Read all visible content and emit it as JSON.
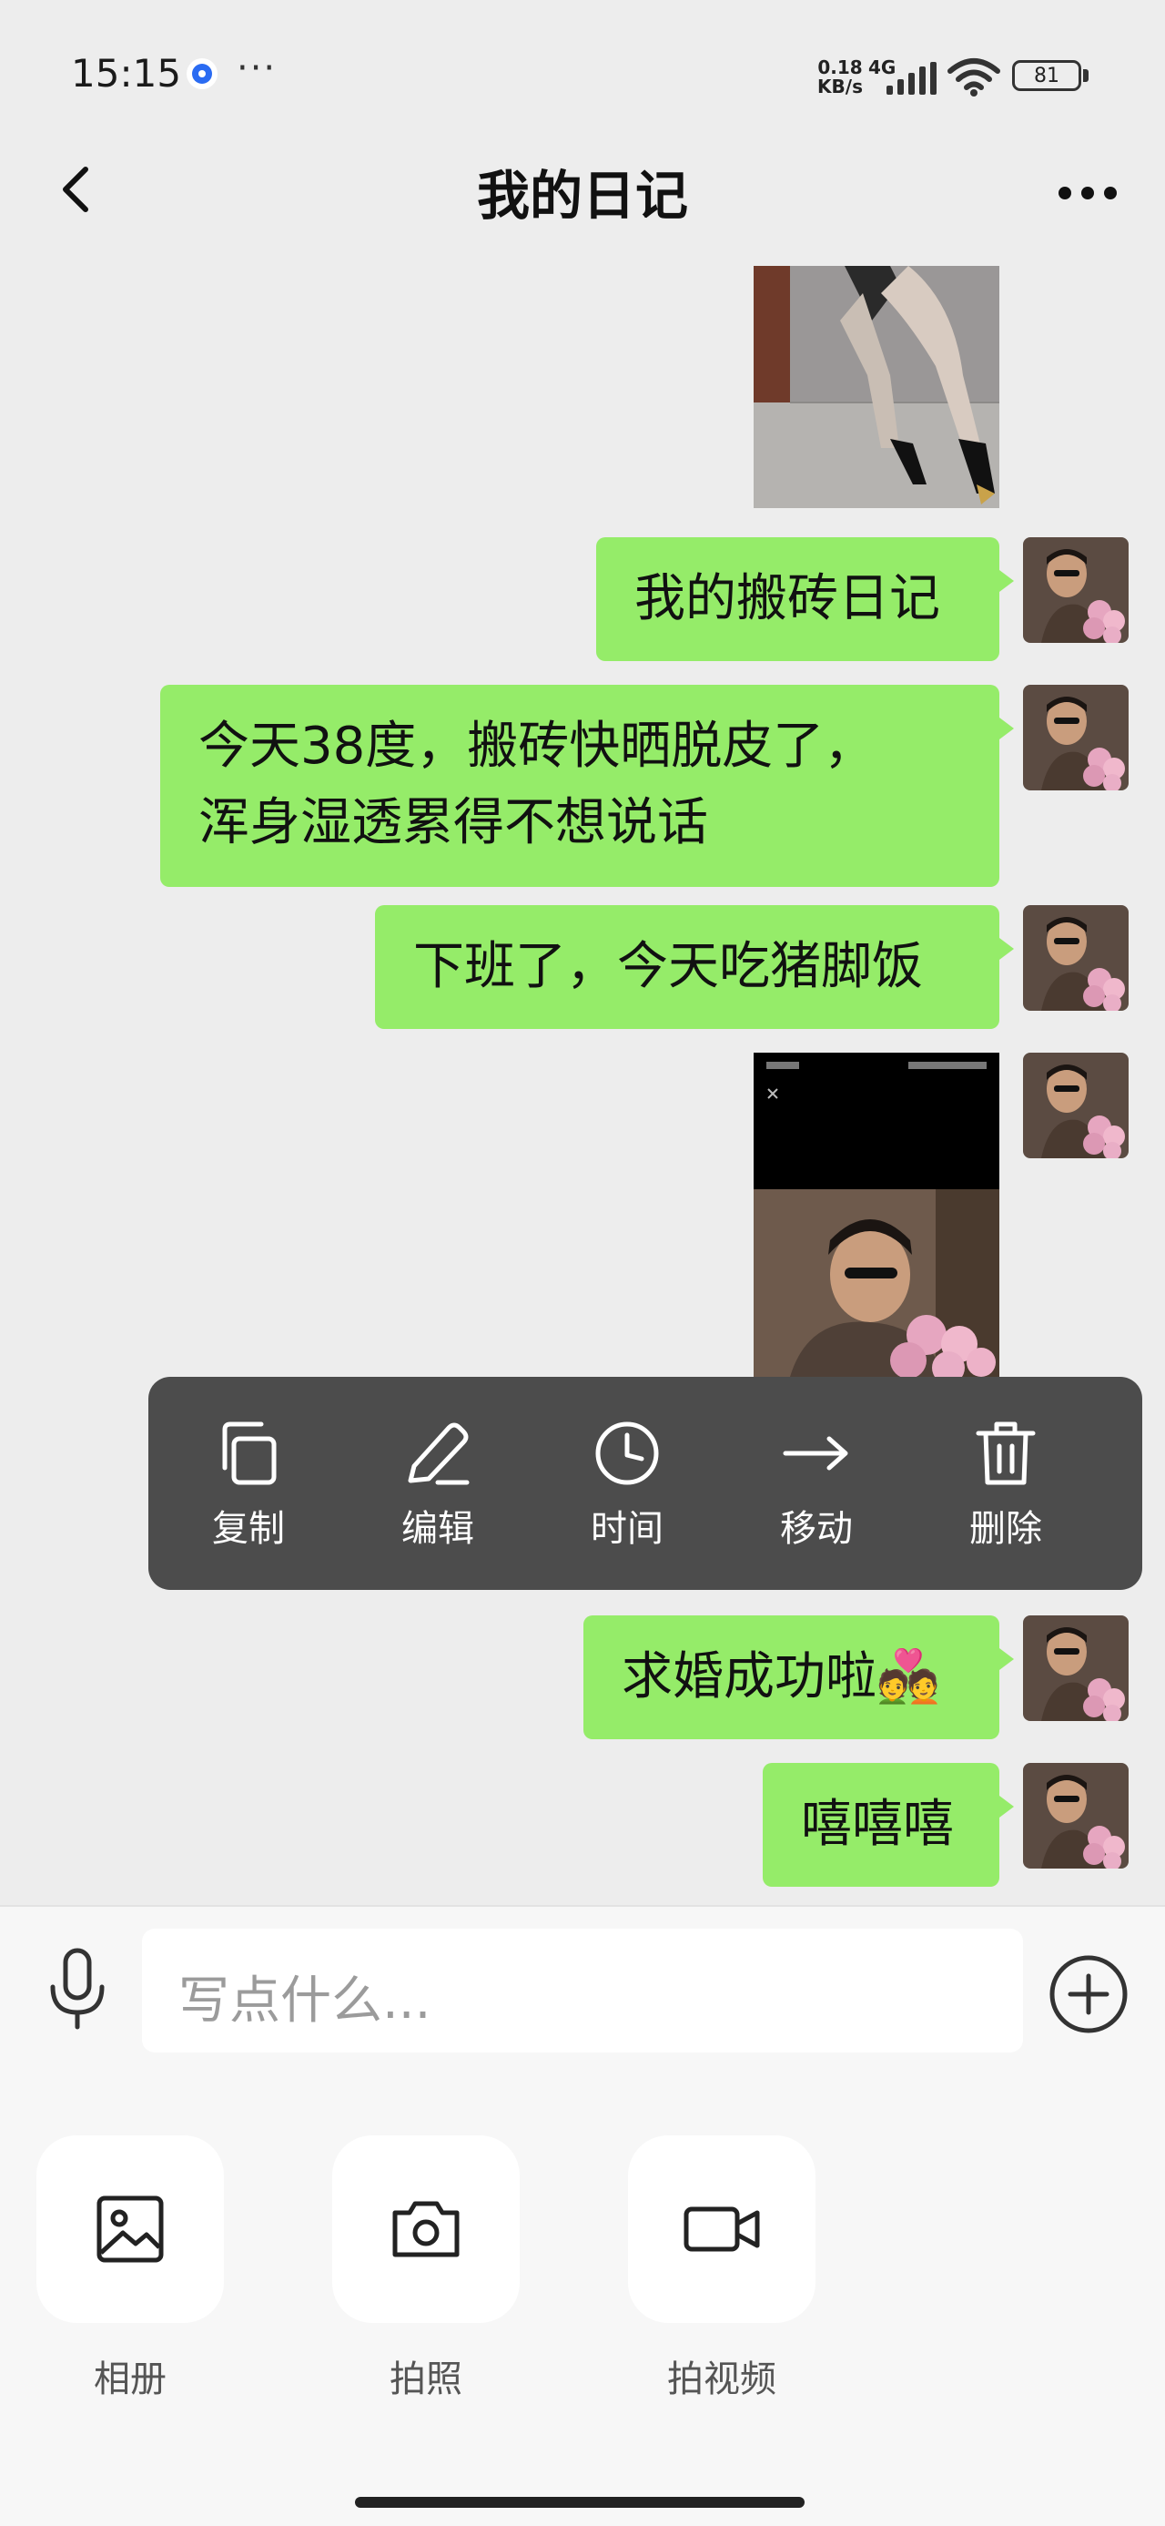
{
  "status_bar": {
    "time": "15:15",
    "more": "···",
    "speed_value": "0.18",
    "speed_unit": "KB/s",
    "network": "4G",
    "battery": "81"
  },
  "nav": {
    "title": "我的日记"
  },
  "messages": [
    {
      "type": "image",
      "desc": "photo"
    },
    {
      "type": "text",
      "lines": [
        "我的搬砖日记"
      ]
    },
    {
      "type": "text",
      "lines": [
        "今天38度，搬砖快晒脱皮了，",
        "浑身湿透累得不想说话"
      ]
    },
    {
      "type": "text",
      "lines": [
        "下班了，今天吃猪脚饭"
      ]
    },
    {
      "type": "image",
      "desc": "screenshot"
    },
    {
      "type": "text",
      "lines": [
        "求婚成功啦💑"
      ]
    },
    {
      "type": "text",
      "lines": [
        "嘻嘻嘻"
      ]
    }
  ],
  "context_menu": {
    "items": [
      {
        "label": "复制",
        "icon": "copy-icon"
      },
      {
        "label": "编辑",
        "icon": "edit-icon"
      },
      {
        "label": "时间",
        "icon": "clock-icon"
      },
      {
        "label": "移动",
        "icon": "arrow-right-icon"
      },
      {
        "label": "删除",
        "icon": "trash-icon"
      }
    ]
  },
  "input": {
    "placeholder": "写点什么..."
  },
  "actions": [
    {
      "label": "相册",
      "icon": "image-icon"
    },
    {
      "label": "拍照",
      "icon": "camera-icon"
    },
    {
      "label": "拍视频",
      "icon": "video-camera-icon"
    }
  ],
  "colors": {
    "bubble": "#95ec69",
    "background": "#ededed",
    "menu": "#4c4c4c"
  }
}
